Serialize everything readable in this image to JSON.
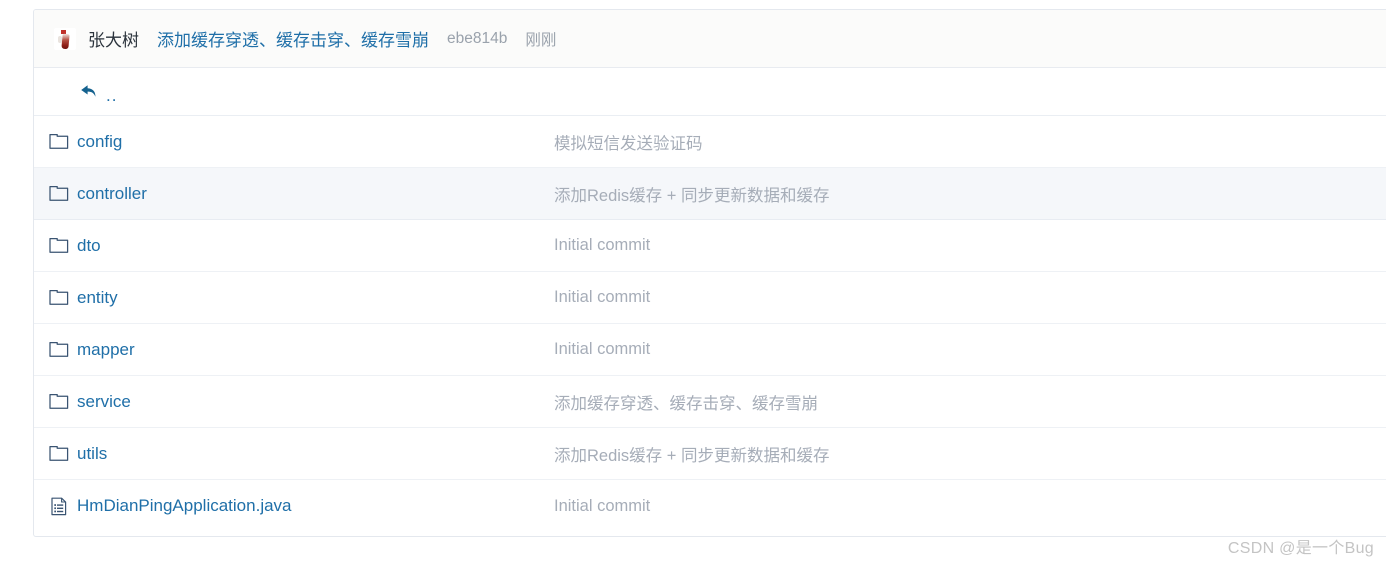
{
  "commit_header": {
    "avatar_icon": "user-avatar-image",
    "author": "张大树",
    "message": "添加缓存穿透、缓存击穿、缓存雪崩",
    "sha": "ebe814b",
    "time": "刚刚"
  },
  "parent_row": {
    "icon": "back-arrow-icon",
    "label": ".."
  },
  "colors": {
    "link": "#1f6fa8",
    "muted": "#a6adb8",
    "header_bg": "#fbfbfa",
    "row_alt_bg": "#f5f7fa",
    "border": "#eef1f5"
  },
  "entries": [
    {
      "icon": "folder-icon",
      "type": "folder",
      "name": "config",
      "commit": "模拟短信发送验证码",
      "highlighted": false
    },
    {
      "icon": "folder-icon",
      "type": "folder",
      "name": "controller",
      "commit": "添加Redis缓存 + 同步更新数据和缓存",
      "highlighted": true
    },
    {
      "icon": "folder-icon",
      "type": "folder",
      "name": "dto",
      "commit": "Initial commit",
      "highlighted": false
    },
    {
      "icon": "folder-icon",
      "type": "folder",
      "name": "entity",
      "commit": "Initial commit",
      "highlighted": false
    },
    {
      "icon": "folder-icon",
      "type": "folder",
      "name": "mapper",
      "commit": "Initial commit",
      "highlighted": false
    },
    {
      "icon": "folder-icon",
      "type": "folder",
      "name": "service",
      "commit": "添加缓存穿透、缓存击穿、缓存雪崩",
      "highlighted": false
    },
    {
      "icon": "folder-icon",
      "type": "folder",
      "name": "utils",
      "commit": "添加Redis缓存 + 同步更新数据和缓存",
      "highlighted": false
    },
    {
      "icon": "file-icon",
      "type": "file",
      "name": "HmDianPingApplication.java",
      "commit": "Initial commit",
      "highlighted": false
    }
  ],
  "watermark": {
    "text": "CSDN @是一个Bug"
  }
}
